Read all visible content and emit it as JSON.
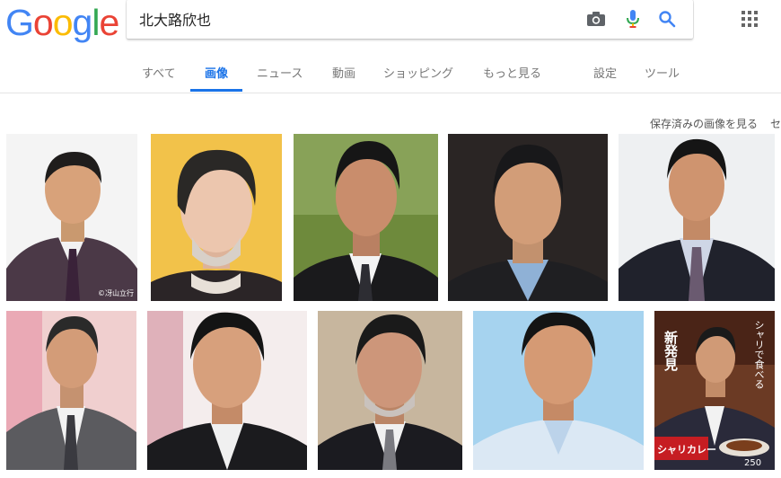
{
  "logo": {
    "text": "Google",
    "letters": [
      "G",
      "o",
      "o",
      "g",
      "l",
      "e"
    ],
    "colors": [
      "#4285f4",
      "#ea4335",
      "#fbbc05",
      "#4285f4",
      "#34a853",
      "#ea4335"
    ]
  },
  "search": {
    "query": "北大路欣也"
  },
  "tabs": [
    {
      "label": "すべて"
    },
    {
      "label": "画像"
    },
    {
      "label": "ニュース"
    },
    {
      "label": "動画"
    },
    {
      "label": "ショッピング"
    },
    {
      "label": "もっと見る"
    },
    {
      "label": "設定"
    },
    {
      "label": "ツール"
    }
  ],
  "active_tab": "画像",
  "saved_images_link": "保存済みの画像を見る",
  "saved_cut_text": "セ",
  "results": {
    "row1": [
      {
        "name": "thumb-1",
        "watermark": "©冴山立行"
      },
      {
        "name": "thumb-2"
      },
      {
        "name": "thumb-3"
      },
      {
        "name": "thumb-4"
      },
      {
        "name": "thumb-5"
      }
    ],
    "row2": [
      {
        "name": "thumb-6"
      },
      {
        "name": "thumb-7"
      },
      {
        "name": "thumb-8"
      },
      {
        "name": "thumb-9"
      },
      {
        "name": "thumb-10",
        "ad_title": "新発見",
        "ad_vertical": "シャリで食べる",
        "ad_product": "シャリカレー",
        "ad_price": "250"
      }
    ]
  },
  "colors": {
    "accent": "#1a73e8",
    "mic_blue": "#4285f4",
    "mic_red": "#ea4335"
  }
}
